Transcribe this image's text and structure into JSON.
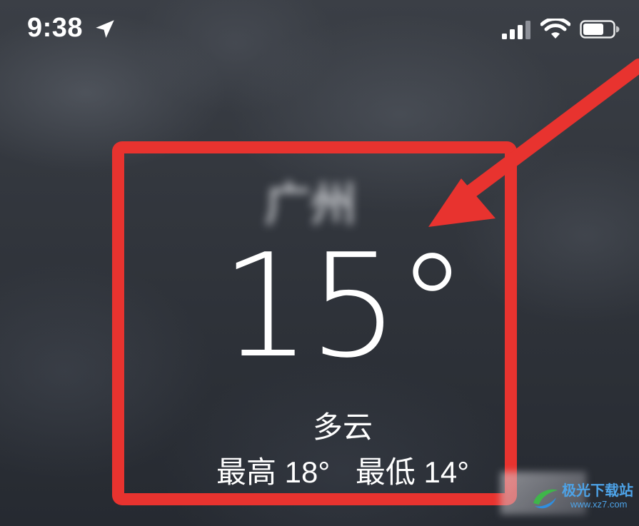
{
  "status_bar": {
    "time": "9:38",
    "location_icon": "location-arrow-icon",
    "signal_icon": "cellular-signal-icon",
    "wifi_icon": "wifi-icon",
    "battery_icon": "battery-icon"
  },
  "weather": {
    "city": "广州",
    "temperature": "15°",
    "condition": "多云",
    "high": "最高 18°",
    "low": "最低 14°"
  },
  "annotation": {
    "color": "#e8332f"
  },
  "watermark": {
    "text": "极光下载站",
    "url": "www.xz7.com"
  }
}
